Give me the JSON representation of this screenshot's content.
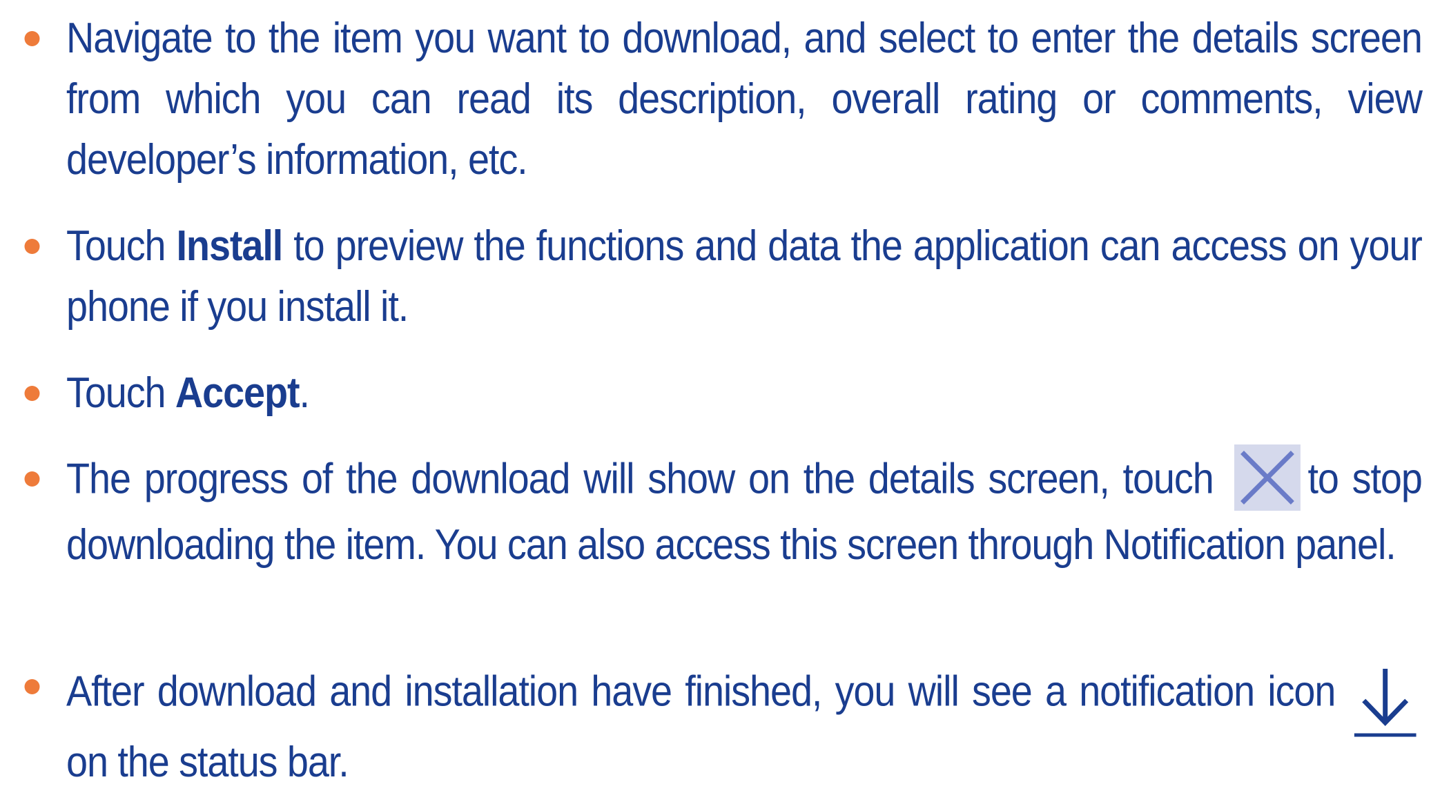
{
  "colors": {
    "text": "#1a3d8f",
    "bullet": "#ee7b3a",
    "icon_bg": "#d5d9ec",
    "icon_stroke": "#6a7bc8"
  },
  "bullets": [
    {
      "text": "Navigate to the item you want to download, and select to enter the details screen from which you can read its description, overall rating or comments, view developer’s information, etc."
    },
    {
      "pre": "Touch ",
      "bold": "Install",
      "post": " to preview the functions and data the application can access on your phone if you install it."
    },
    {
      "pre": "Touch ",
      "bold": "Accept",
      "post": "."
    },
    {
      "pre": "The progress of the download will show on the details screen, touch",
      "icon": "close-icon",
      "post": "to stop downloading the item. You can also access this screen through Notification panel."
    },
    {
      "pre": "After download and installation have finished, you will see a notification icon",
      "icon": "download-arrow-icon",
      "post": "on the status bar."
    }
  ]
}
